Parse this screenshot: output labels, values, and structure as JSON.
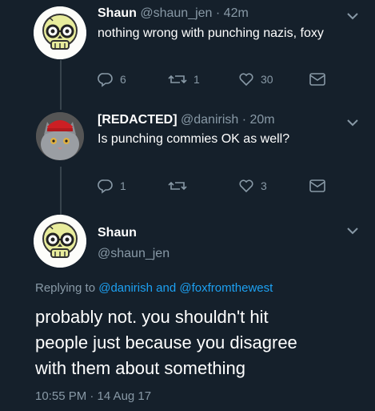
{
  "tweets": [
    {
      "name": "Shaun",
      "handle": "@shaun_jen",
      "time": "· 42m",
      "text": "nothing wrong with punching nazis, foxy",
      "replies": "6",
      "retweets": "1",
      "likes": "30"
    },
    {
      "name": "[REDACTED]",
      "handle": "@danirish",
      "time": "· 20m",
      "text": "Is punching commies OK as well?",
      "replies": "1",
      "retweets": "",
      "likes": "3"
    }
  ],
  "main": {
    "name": "Shaun",
    "handle": "@shaun_jen",
    "replying_prefix": "Replying to",
    "reply_user1": "@danirish",
    "reply_and": "and",
    "reply_user2": "@foxfromthewest",
    "text_line1": "probably not. you shouldn't hit",
    "text_line2": "people just because you disagree",
    "text_line3": "with them about something",
    "timestamp": "10:55 PM · 14 Aug 17"
  },
  "colors": {
    "background": "#15202b",
    "secondary_text": "#8899a6",
    "link": "#1da1f2",
    "divider": "#38444d"
  },
  "icons": [
    "skull-avatar",
    "cat-avatar",
    "reply-icon",
    "retweet-icon",
    "like-icon",
    "dm-icon",
    "chevron-down-icon"
  ]
}
